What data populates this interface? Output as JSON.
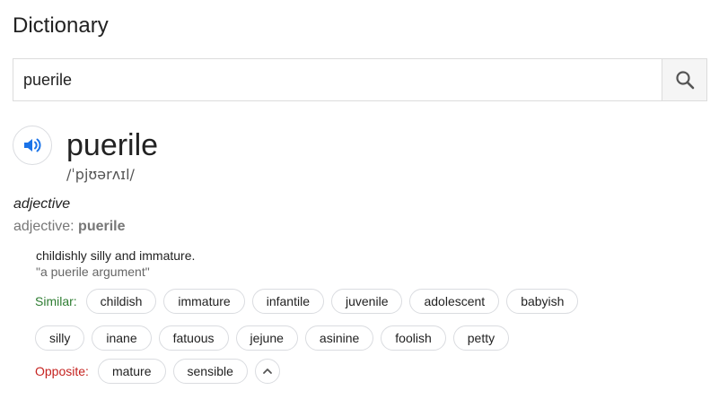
{
  "page": {
    "title": "Dictionary"
  },
  "search": {
    "value": "puerile",
    "icon": "search-icon"
  },
  "entry": {
    "word": "puerile",
    "phonetic": "/ˈpjʊərʌɪl/",
    "speaker_icon": "speaker-icon",
    "part_of_speech": "adjective",
    "pos_prefix": "adjective: ",
    "pos_word": "puerile",
    "definition": "childishly silly and immature.",
    "example": "\"a puerile argument\"",
    "similar_label": "Similar:",
    "similar_row1": [
      "childish",
      "immature",
      "infantile",
      "juvenile",
      "adolescent",
      "babyish"
    ],
    "similar_row2": [
      "silly",
      "inane",
      "fatuous",
      "jejune",
      "asinine",
      "foolish",
      "petty"
    ],
    "opposite_label": "Opposite:",
    "opposite": [
      "mature",
      "sensible"
    ],
    "collapse_icon": "chevron-up-icon"
  },
  "colors": {
    "similar": "#2e7d32",
    "opposite": "#c5221f",
    "speaker_accent": "#1a73e8"
  }
}
